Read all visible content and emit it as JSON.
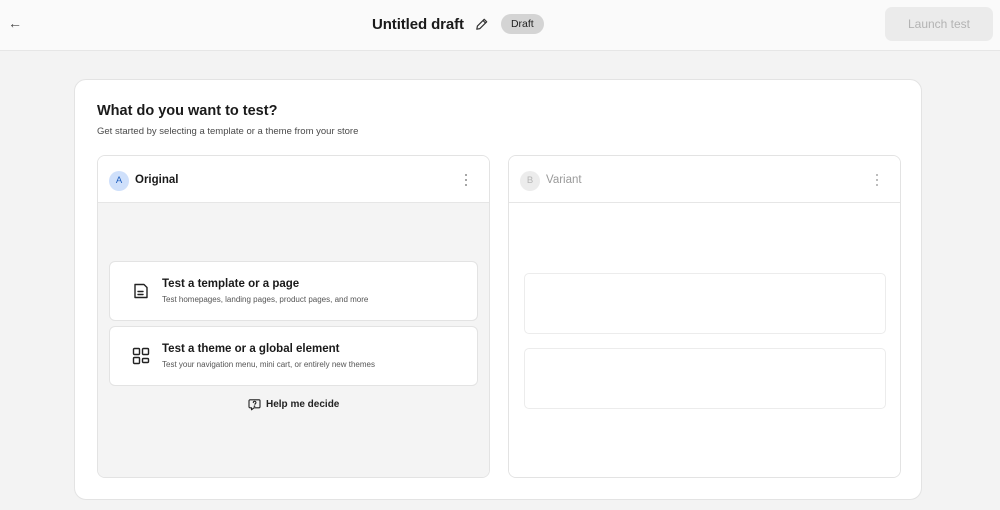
{
  "topbar": {
    "back_icon": "arrow-left-icon",
    "title": "Untitled draft",
    "edit_icon": "pencil-icon",
    "status_badge": "Draft",
    "launch_label": "Launch test"
  },
  "card": {
    "title": "What do you want to test?",
    "subtitle": "Get started by selecting a template or a theme from your store"
  },
  "panel_a": {
    "letter": "A",
    "label": "Original",
    "menu_icon": "kebab-menu-icon",
    "options": [
      {
        "icon": "page-template-icon",
        "title": "Test a template or a page",
        "description": "Test homepages, landing pages, product pages, and more"
      },
      {
        "icon": "layout-grid-icon",
        "title": "Test a theme or a global element",
        "description": "Test your navigation menu, mini cart, or entirely new themes"
      }
    ],
    "help": {
      "icon": "help-bubble-icon",
      "label": "Help me decide"
    }
  },
  "panel_b": {
    "letter": "B",
    "label": "Variant",
    "menu_icon": "kebab-menu-icon"
  },
  "colors": {
    "accent_badge_bg": "#cfe0fb",
    "accent_badge_text": "#1f5fbf",
    "disabled_button_bg": "#ebebeb",
    "disabled_button_text": "#b3b3b3",
    "draft_badge_bg": "#d4d4d4"
  }
}
